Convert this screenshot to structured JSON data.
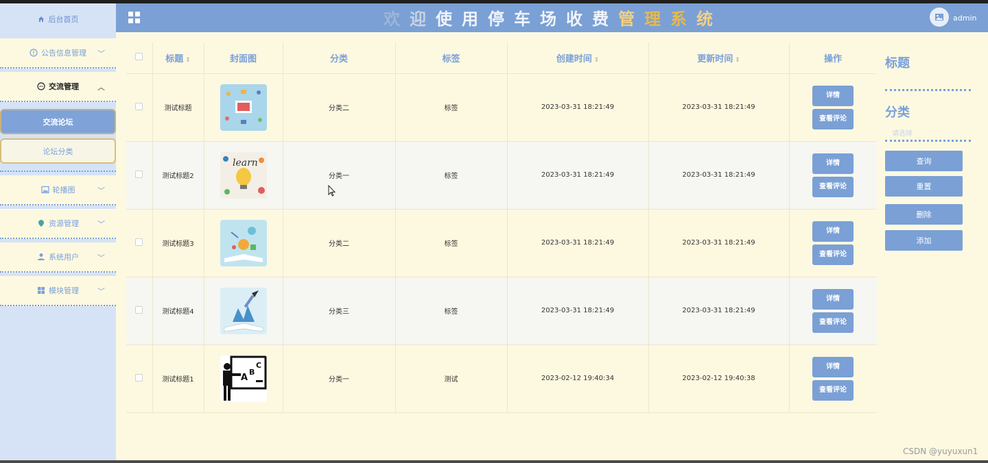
{
  "sidebar": {
    "home": "后台首页",
    "menu": [
      {
        "label": "公告信息管理",
        "icon": "info-circle-icon"
      },
      {
        "label": "交流管理",
        "icon": "chat-icon",
        "open": true,
        "children": [
          "交流论坛",
          "论坛分类"
        ]
      },
      {
        "label": "轮播图",
        "icon": "image-icon"
      },
      {
        "label": "资源管理",
        "icon": "location-pin-icon"
      },
      {
        "label": "系统用户",
        "icon": "user-icon"
      },
      {
        "label": "模块管理",
        "icon": "grid-icon"
      }
    ]
  },
  "header": {
    "title": "欢迎使用停车场收费管理系统",
    "user": "admin"
  },
  "table": {
    "columns": [
      "标题",
      "封面图",
      "分类",
      "标签",
      "创建时间",
      "更新时间",
      "操作"
    ],
    "rows": [
      {
        "title": "测试标题",
        "category": "分类二",
        "tag": "标签",
        "created": "2023-03-31 18:21:49",
        "updated": "2023-03-31 18:21:49",
        "cover": "analytics-illustration"
      },
      {
        "title": "测试标题2",
        "category": "分类一",
        "tag": "标签",
        "created": "2023-03-31 18:21:49",
        "updated": "2023-03-31 18:21:49",
        "cover": "learn-lightbulb-illustration"
      },
      {
        "title": "测试标题3",
        "category": "分类二",
        "tag": "标签",
        "created": "2023-03-31 18:21:49",
        "updated": "2023-03-31 18:21:49",
        "cover": "open-book-illustration"
      },
      {
        "title": "测试标题4",
        "category": "分类三",
        "tag": "标签",
        "created": "2023-03-31 18:21:49",
        "updated": "2023-03-31 18:21:49",
        "cover": "book-pencil-illustration"
      },
      {
        "title": "测试标题1",
        "category": "分类一",
        "tag": "测试",
        "created": "2023-02-12 19:40:34",
        "updated": "2023-02-12 19:40:38",
        "cover": "teacher-blackboard-illustration"
      }
    ],
    "actions": {
      "detail": "详情",
      "comments": "查看评论"
    }
  },
  "search": {
    "title_label": "标题",
    "category_label": "分类",
    "category_placeholder": "请选择",
    "query": "查询",
    "reset": "重置",
    "delete": "删除",
    "add": "添加"
  },
  "watermark": "CSDN @yuyuxun1",
  "colors": {
    "primary": "#7aa0d5",
    "background": "#fdf9e1",
    "sidebar": "#d6e3f6"
  }
}
